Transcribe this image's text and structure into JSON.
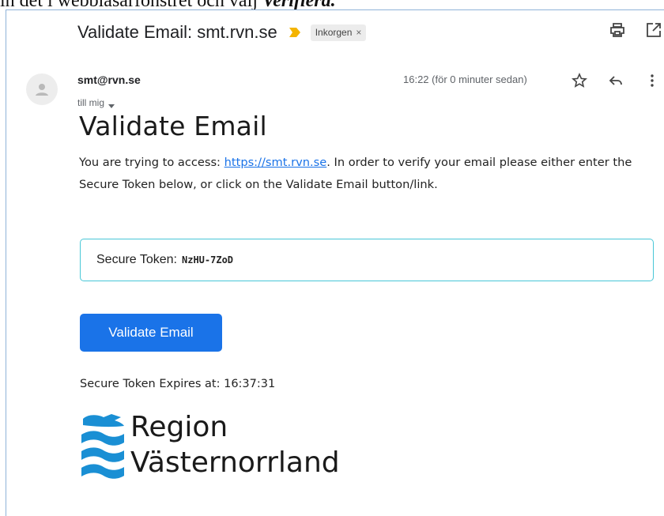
{
  "caption": {
    "prefix": "in det i webbläsarfönstret och välj",
    "emphasis": "Verifiera."
  },
  "email": {
    "subject": "Validate Email: smt.rvn.se",
    "label_chip": "Inkorgen",
    "label_chip_close": "×",
    "sender": "smt@rvn.se",
    "recipient": "till mig",
    "timestamp": "16:22 (för 0 minuter sedan)"
  },
  "icons": {
    "important": "important-marker-icon",
    "print": "print-icon",
    "popout": "open-in-new-window-icon",
    "avatar": "person-icon",
    "dropdown": "caret-down-icon",
    "star": "star-icon",
    "reply": "reply-icon",
    "more": "more-vertical-icon"
  },
  "body": {
    "heading": "Validate Email",
    "intro_before_link": "You are trying to access: ",
    "link_text": "https://smt.rvn.se",
    "intro_after_link": ". In order to verify your email please either enter the Secure Token below, or click on the Validate Email button/link.",
    "token_label": "Secure Token:",
    "token_value": "NzHU-7ZoD",
    "button_label": "Validate Email",
    "expires_text": "Secure Token Expires at: 16:37:31"
  },
  "logo": {
    "line1": "Region",
    "line2": "Västernorrland"
  },
  "colors": {
    "button": "#1a73e8",
    "token_border": "#48c7d7",
    "logo_blue": "#1a8fd4",
    "important": "#f4b400",
    "frame_border": "#8fb3d9"
  }
}
